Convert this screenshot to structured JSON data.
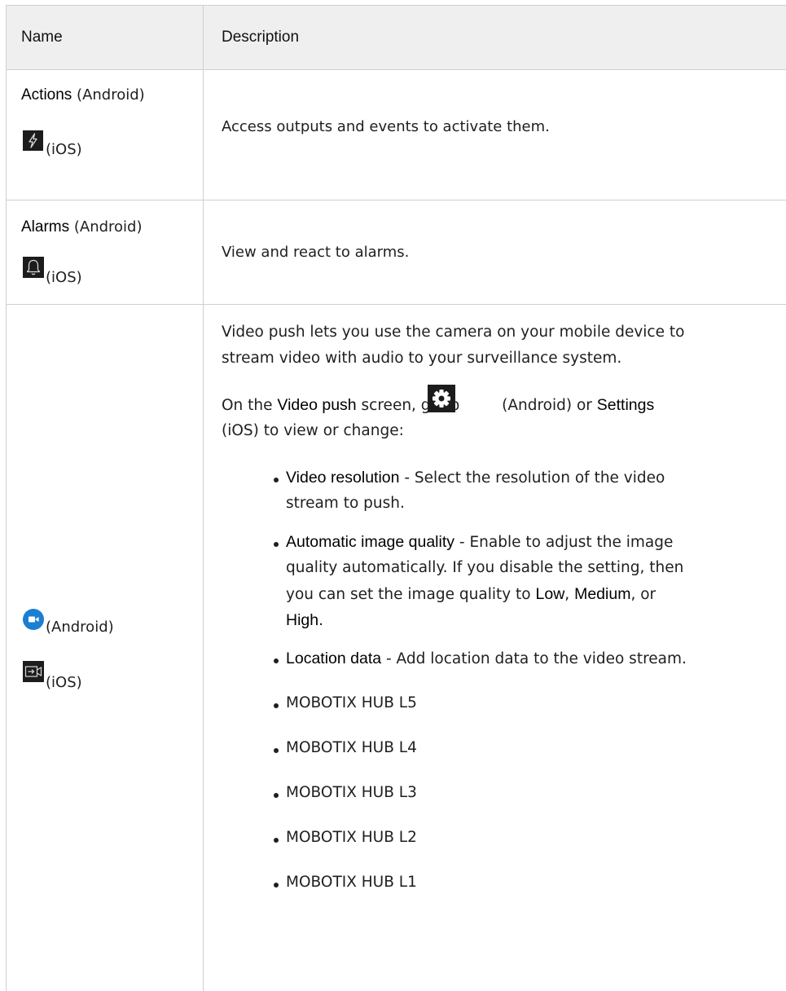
{
  "table": {
    "headers": {
      "name": "Name",
      "description": "Description"
    },
    "rows": [
      {
        "name_bold": "Actions",
        "name_suffix": "(Android)",
        "icon_label": "(iOS)",
        "description": "Access outputs and events to activate them."
      },
      {
        "name_bold": "Alarms",
        "name_suffix": "(Android)",
        "icon_label": "(iOS)",
        "description": "View and react to alarms."
      },
      {
        "android_label": "(Android)",
        "ios_label": "(iOS)",
        "intro_line1": "Video push lets you use the camera on your mobile device to",
        "intro_line2": "stream video with audio to your surveillance system.",
        "settings": {
          "p_on_the": "On the",
          "p_video_push": "Video push",
          "p_screen_go_to": "screen, go to",
          "p_android_or": "(Android) or",
          "p_settings": "Settings",
          "p_ios_to_view": "(iOS) to view or change:"
        },
        "bullets": {
          "video_resolution": {
            "term": "Video resolution",
            "line1": " - Select the resolution of the video",
            "line2": "stream to push."
          },
          "auto_quality": {
            "term": "Automatic image quality",
            "line1": " - Enable to adjust the image",
            "line2": "quality automatically. If you disable the setting, then",
            "line3_pre": "you can set the image quality to",
            "low": "Low",
            "comma1": ",",
            "medium": "Medium",
            "or": ", or",
            "high": "High",
            "period": "."
          },
          "location": {
            "term": "Location data",
            "line1": " - Add location data to the video stream."
          },
          "products": [
            "MOBOTIX HUB L5",
            "MOBOTIX HUB L4",
            "MOBOTIX HUB L3",
            "MOBOTIX HUB L2",
            "MOBOTIX HUB L1"
          ]
        }
      }
    ]
  },
  "icons": {
    "actions_ios": "lightning-icon",
    "alarms_ios": "bell-icon",
    "settings_android": "gear-icon",
    "video_push_android": "video-camera-icon",
    "video_push_ios": "video-push-icon"
  },
  "colors": {
    "header_bg": "#efefef",
    "border": "#cfcfcf",
    "android_blue": "#1b7fd1"
  }
}
